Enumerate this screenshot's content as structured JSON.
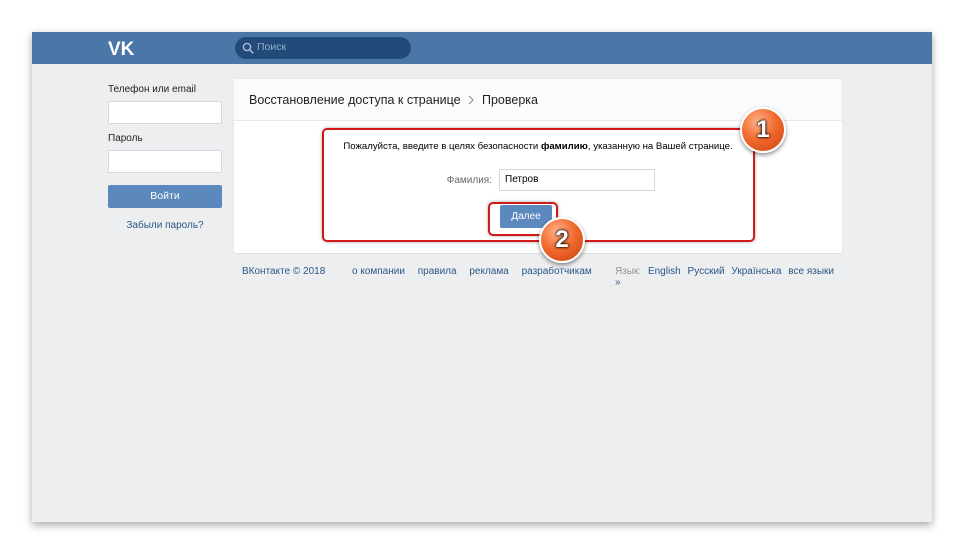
{
  "header": {
    "logo": "vk-logo",
    "search_placeholder": "Поиск"
  },
  "login": {
    "phone_label": "Телефон или email",
    "password_label": "Пароль",
    "login_button": "Войти",
    "forgot_link": "Забыли пароль?"
  },
  "recovery": {
    "breadcrumb_main": "Восстановление доступа к странице",
    "breadcrumb_current": "Проверка",
    "message_before": "Пожалуйста, введите в целях безопасности ",
    "message_bold": "фамилию",
    "message_after": ", указанную на Вашей странице.",
    "surname_label": "Фамилия:",
    "surname_value": "Петров",
    "next_button": "Далее"
  },
  "annotations": {
    "badge_1": "1",
    "badge_2": "2",
    "highlight_color": "#d01a1a",
    "badge_color": "#f26b2f"
  },
  "footer": {
    "copyright": "ВКонтакте © 2018",
    "links": [
      "о компании",
      "правила",
      "реклама",
      "разработчикам"
    ],
    "language_label": "Язык:",
    "languages": [
      "English",
      "Русский",
      "Українська",
      "все языки »"
    ]
  },
  "colors": {
    "topbar": "#4a76a8",
    "button": "#5b88bd",
    "link": "#2a5885",
    "background": "#edeef0"
  }
}
